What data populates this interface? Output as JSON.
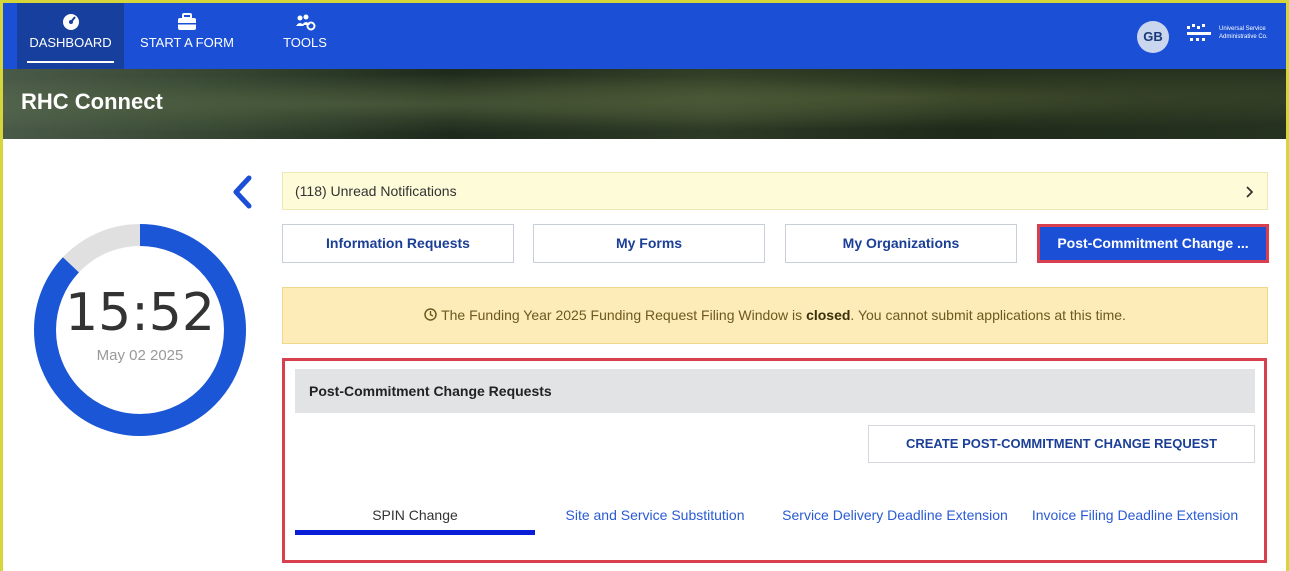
{
  "nav": {
    "items": [
      {
        "label": "DASHBOARD",
        "icon": "dashboard-gauge-icon",
        "active": true
      },
      {
        "label": "START A FORM",
        "icon": "briefcase-icon",
        "active": false
      },
      {
        "label": "TOOLS",
        "icon": "users-cog-icon",
        "active": false
      }
    ],
    "avatar_initials": "GB",
    "logo_text_line1": "Universal Service",
    "logo_text_line2": "Administrative Co."
  },
  "banner": {
    "title": "RHC Connect"
  },
  "clock": {
    "time": "15:52",
    "date": "May 02 2025",
    "progress": 0.87
  },
  "notifications": {
    "label": "(118) Unread Notifications"
  },
  "tabs": [
    {
      "label": "Information Requests",
      "active": false
    },
    {
      "label": "My Forms",
      "active": false
    },
    {
      "label": "My Organizations",
      "active": false
    },
    {
      "label": "Post-Commitment Change ...",
      "active": true
    }
  ],
  "alert": {
    "prefix": "The Funding Year 2025 Funding Request Filing Window is ",
    "bold": "closed",
    "suffix": ". You cannot submit applications at this time."
  },
  "panel": {
    "title": "Post-Commitment Change Requests",
    "create_button": "CREATE POST-COMMITMENT CHANGE REQUEST",
    "subtabs": [
      {
        "label": "SPIN Change",
        "active": true
      },
      {
        "label": "Site and Service Substitution",
        "active": false
      },
      {
        "label": "Service Delivery Deadline Extension",
        "active": false
      },
      {
        "label": "Invoice Filing Deadline Extension",
        "active": false
      }
    ]
  },
  "colors": {
    "nav_blue": "#1a4fd6",
    "highlight_red": "#d9404f",
    "clock_blue": "#1a56d6",
    "alert_bg": "#fdebb8",
    "notif_bg": "#fdfbd8"
  }
}
